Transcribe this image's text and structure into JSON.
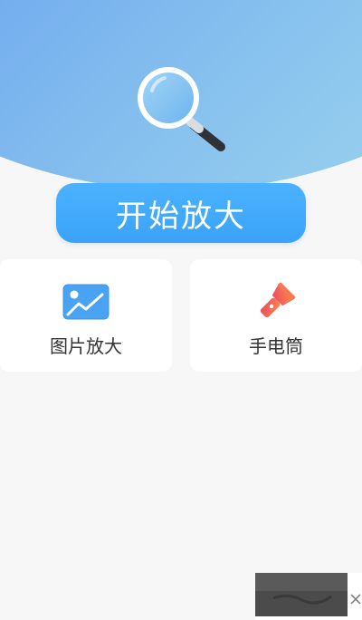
{
  "start_button": {
    "label": "开始放大"
  },
  "features": [
    {
      "label": "图片放大",
      "icon": "image-icon"
    },
    {
      "label": "手电筒",
      "icon": "flashlight-icon"
    }
  ],
  "colors": {
    "header_gradient_start": "#5b8ff0",
    "header_gradient_end": "#a6dcea",
    "button": "#3ea8fa",
    "image_icon": "#4aa3f2",
    "flashlight_icon": "#f0566b",
    "background": "#f7f7f7",
    "card": "#ffffff",
    "text": "#333333"
  }
}
